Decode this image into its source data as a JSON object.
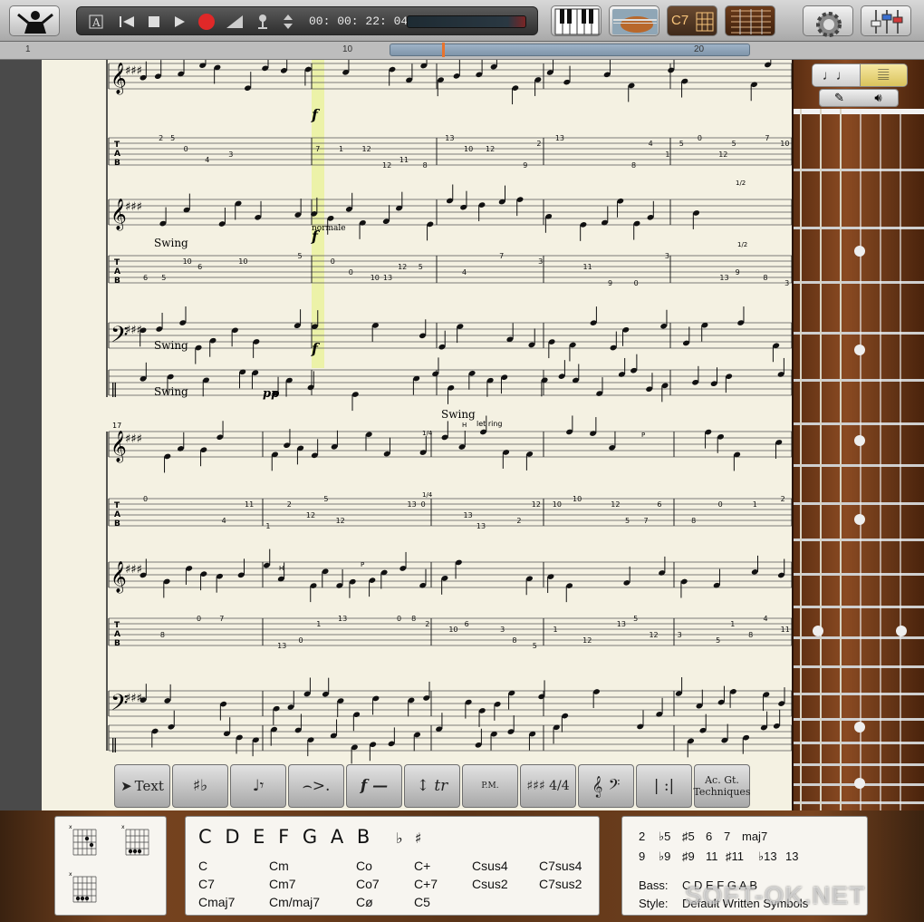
{
  "transport": {
    "time": "00: 00: 22: 04"
  },
  "toolbar": {
    "chord_button_label": "C7"
  },
  "ruler": {
    "marks": [
      "1",
      "10",
      "20"
    ]
  },
  "score": {
    "style_text": "Swing",
    "dynamic_f": "f",
    "dynamic_pp": "pp",
    "normale": "normale",
    "let_ring": "let ring",
    "measure_17": "17",
    "bend_quarter": "1/4",
    "bend_half": "1/2",
    "tech_H": "H",
    "tech_P": "P"
  },
  "palette": {
    "text": "Text",
    "accidentals": "♯♭",
    "note_rest": "♩𝄾",
    "articulation": "⌢>.",
    "dynamics": "f —",
    "ornament": "↕ tr",
    "pm": "P.M.",
    "key_time": "♯♯♯ 4/4",
    "clef": "𝄞 𝄢",
    "barline": "| :|",
    "techniques_line1": "Ac. Gt.",
    "techniques_line2": "Techniques"
  },
  "chord_panel": {
    "notes": "C D E F G A B",
    "accidentals": "♭ ♯",
    "chords": [
      [
        "C",
        "Cm",
        "Co",
        "C+",
        "Csus4",
        "C7sus4"
      ],
      [
        "C7",
        "Cm7",
        "Co7",
        "C+7",
        "Csus2",
        "C7sus2"
      ],
      [
        "Cmaj7",
        "Cm/maj7",
        "Cø",
        "C5",
        "",
        ""
      ]
    ],
    "extensions_row1": [
      "2",
      "♭5",
      "♯5",
      "6",
      "7",
      "maj7"
    ],
    "extensions_row2": [
      "9",
      "♭9",
      "♯9",
      "11",
      "♯11",
      "♭13",
      "13"
    ],
    "bass_label": "Bass:",
    "bass_notes": "C  D  E  F  G  A  B",
    "style_label": "Style:",
    "style_values": "Default  Written  Symbols"
  },
  "watermark": "SOFT-OK.NET",
  "colors": {
    "paper": "#f4f1e2",
    "highlight": "#eaf39a",
    "record": "#e02828",
    "playhead": "#e8732d"
  }
}
